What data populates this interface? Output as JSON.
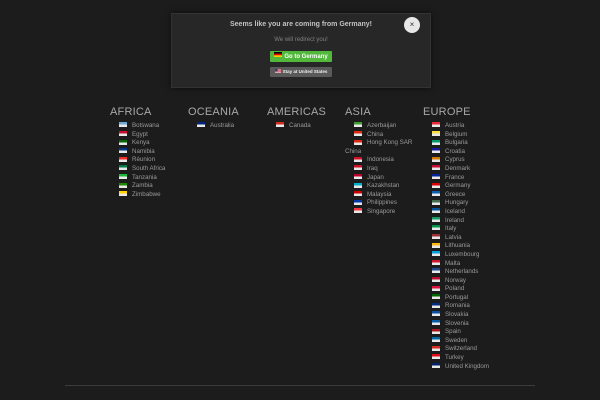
{
  "modal": {
    "title": "Seems like you are coming from Germany!",
    "subtitle": "We will redirect you!",
    "go_button": "Go to Germany",
    "stay_button": "Stay at United States",
    "close": "×"
  },
  "columns": [
    {
      "heading": "AFRICA",
      "countries": [
        {
          "name": "Botswana",
          "flag": "#6da9d2"
        },
        {
          "name": "Egypt",
          "flag": "#c8102e"
        },
        {
          "name": "Kenya",
          "flag": "#006600"
        },
        {
          "name": "Namibia",
          "flag": "#003580"
        },
        {
          "name": "Réunion",
          "flag": "#ef2b2d"
        },
        {
          "name": "South Africa",
          "flag": "#007749"
        },
        {
          "name": "Tanzania",
          "flag": "#1eb53a"
        },
        {
          "name": "Zambia",
          "flag": "#198a00"
        },
        {
          "name": "Zimbabwe",
          "flag": "#ffd200"
        }
      ]
    },
    {
      "heading": "OCEANIA",
      "countries": [
        {
          "name": "Australia",
          "flag": "#00247d"
        }
      ]
    },
    {
      "heading": "AMERICAS",
      "countries": [
        {
          "name": "Canada",
          "flag": "#d52b1e"
        }
      ]
    },
    {
      "heading": "ASIA",
      "countries": [
        {
          "name": "Azerbaijan",
          "flag": "#3f9c35"
        },
        {
          "name": "China",
          "flag": "#de2910"
        },
        {
          "name": "Hong Kong SAR",
          "flag": "#de2910"
        },
        {
          "name": "China",
          "flag": ""
        },
        {
          "name": "Indonesia",
          "flag": "#ce1126"
        },
        {
          "name": "Iraq",
          "flag": "#ce1126"
        },
        {
          "name": "Japan",
          "flag": "#bc002d"
        },
        {
          "name": "Kazakhstan",
          "flag": "#00afca"
        },
        {
          "name": "Malaysia",
          "flag": "#cc0001"
        },
        {
          "name": "Philippines",
          "flag": "#0038a8"
        },
        {
          "name": "Singapore",
          "flag": "#ef3340"
        }
      ]
    },
    {
      "heading": "EUROPE",
      "countries": [
        {
          "name": "Austria",
          "flag": "#ed2939"
        },
        {
          "name": "Belgium",
          "flag": "#fae042"
        },
        {
          "name": "Bulgaria",
          "flag": "#00966e"
        },
        {
          "name": "Croatia",
          "flag": "#171796"
        },
        {
          "name": "Cyprus",
          "flag": "#d57800"
        },
        {
          "name": "Denmark",
          "flag": "#c60c30"
        },
        {
          "name": "France",
          "flag": "#002395"
        },
        {
          "name": "Germany",
          "flag": "#dd0000"
        },
        {
          "name": "Greece",
          "flag": "#0d5eaf"
        },
        {
          "name": "Hungary",
          "flag": "#436f4d"
        },
        {
          "name": "Iceland",
          "flag": "#02529c"
        },
        {
          "name": "Ireland",
          "flag": "#169b62"
        },
        {
          "name": "Italy",
          "flag": "#009246"
        },
        {
          "name": "Latvia",
          "flag": "#9e3039"
        },
        {
          "name": "Lithuania",
          "flag": "#fdb913"
        },
        {
          "name": "Luxembourg",
          "flag": "#00a1de"
        },
        {
          "name": "Malta",
          "flag": "#cf142b"
        },
        {
          "name": "Netherlands",
          "flag": "#21468b"
        },
        {
          "name": "Norway",
          "flag": "#ba0c2f"
        },
        {
          "name": "Poland",
          "flag": "#dc143c"
        },
        {
          "name": "Portugal",
          "flag": "#006600"
        },
        {
          "name": "Romania",
          "flag": "#002b7f"
        },
        {
          "name": "Slovakia",
          "flag": "#0b4ea2"
        },
        {
          "name": "Slovenia",
          "flag": "#005da4"
        },
        {
          "name": "Spain",
          "flag": "#aa151b"
        },
        {
          "name": "Sweden",
          "flag": "#006aa7"
        },
        {
          "name": "Switzerland",
          "flag": "#d52b1e"
        },
        {
          "name": "Turkey",
          "flag": "#e30a17"
        },
        {
          "name": "United Kingdom",
          "flag": "#012169"
        }
      ]
    }
  ]
}
